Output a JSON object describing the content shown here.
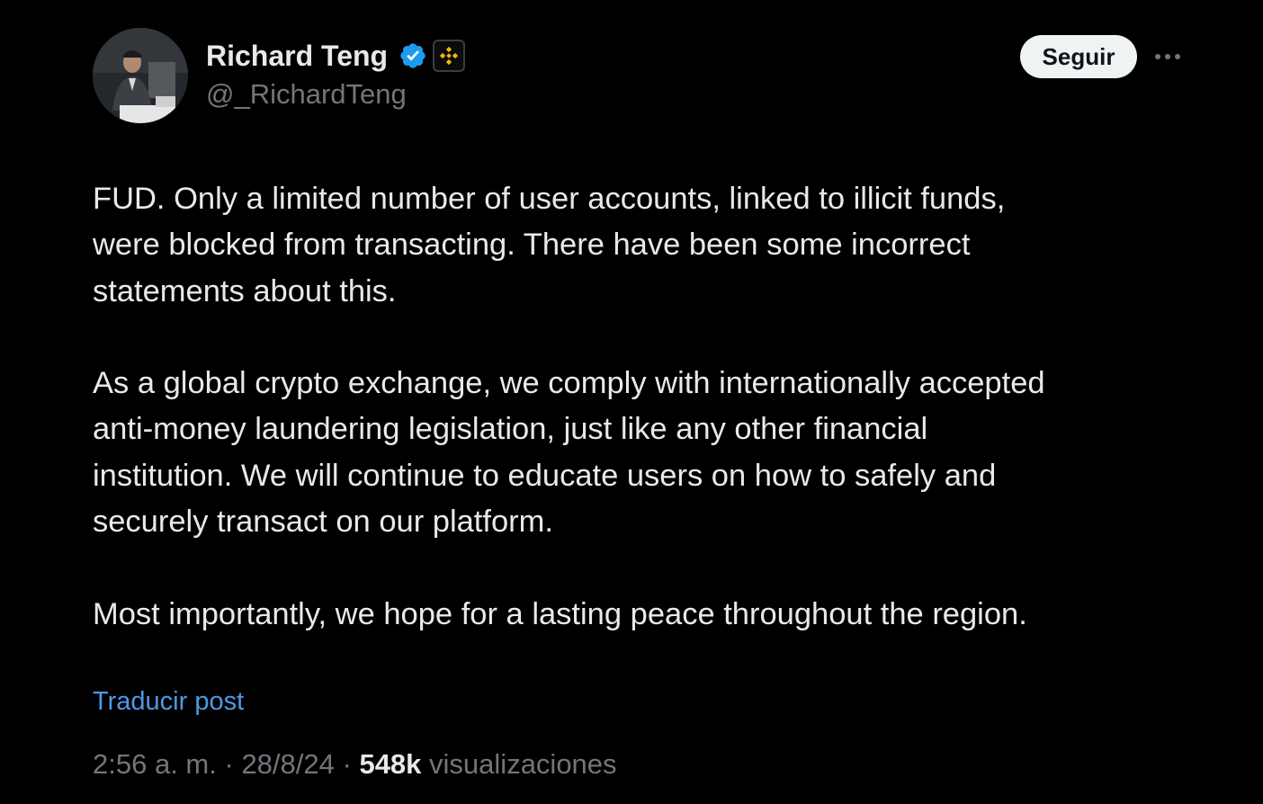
{
  "author": {
    "name": "Richard Teng",
    "handle": "@_RichardTeng",
    "avatar_icon": "profile-photo",
    "verified_badge_color": "#1d9bf0",
    "affiliate_badge_icon": "binance-logo",
    "affiliate_badge_color": "#f0b90b"
  },
  "actions": {
    "follow_label": "Seguir",
    "more_icon": "ellipsis-icon"
  },
  "post": {
    "paragraphs": [
      "FUD. Only a limited number of user accounts, linked to illicit funds,\nwere blocked from transacting. There have been some incorrect\nstatements about this.",
      "As a global crypto exchange, we comply with internationally accepted\nanti-money laundering legislation, just like any other financial\ninstitution. We will continue to educate users on how to safely and\nsecurely transact on our platform.",
      "Most importantly, we hope for a lasting peace throughout the region."
    ],
    "translate_label": "Traducir post"
  },
  "meta": {
    "time": "2:56 a. m.",
    "separator": "·",
    "date": "28/8/24",
    "views_count": "548k",
    "views_label": "visualizaciones"
  },
  "colors": {
    "background": "#000000",
    "text_primary": "#e7e9ea",
    "text_secondary": "#71767b",
    "link": "#4f98e6",
    "button_bg": "#eff3f4"
  }
}
